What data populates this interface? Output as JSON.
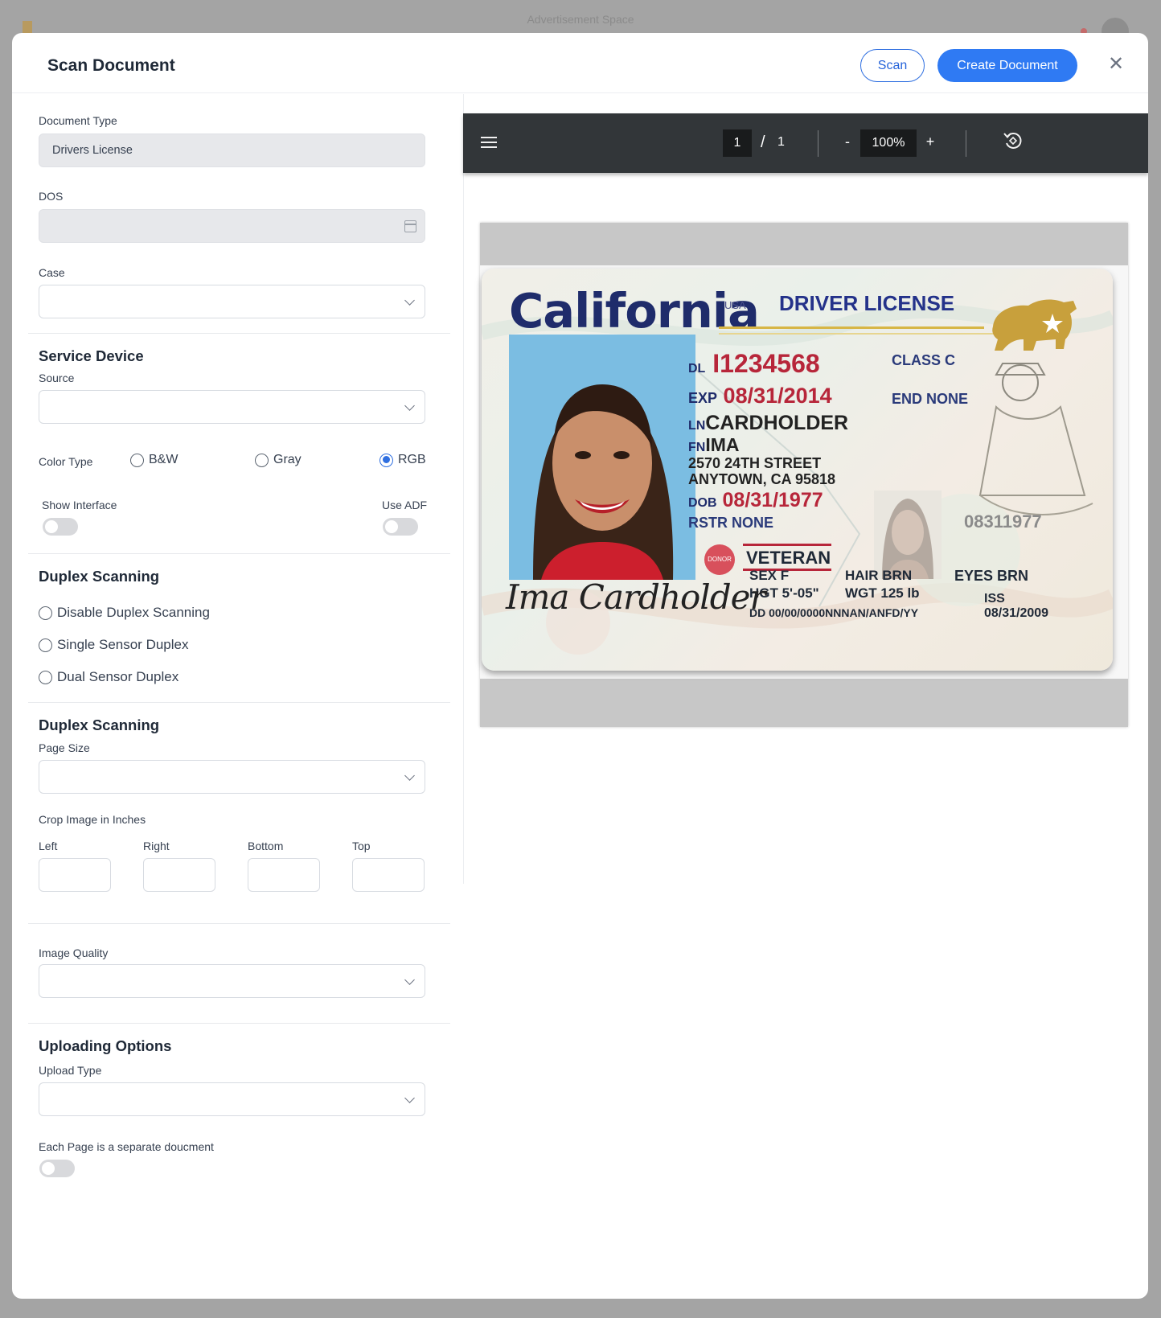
{
  "background": {
    "ad_text": "Advertisement Space"
  },
  "modal": {
    "title": "Scan Document",
    "scan_label": "Scan",
    "create_label": "Create Document",
    "close_glyph": "✕"
  },
  "form": {
    "document_type": {
      "label": "Document Type",
      "value": "Drivers License"
    },
    "dos": {
      "label": "DOS",
      "value": ""
    },
    "case": {
      "label": "Case",
      "value": ""
    },
    "service_device": {
      "title": "Service Device",
      "source_label": "Source",
      "source_value": "",
      "color_type_label": "Color Type",
      "color_options": [
        "B&W",
        "Gray",
        "RGB"
      ],
      "color_selected": "RGB",
      "show_interface_label": "Show Interface",
      "show_interface_on": false,
      "use_adf_label": "Use ADF",
      "use_adf_on": false
    },
    "duplex": {
      "title": "Duplex Scanning",
      "options": [
        "Disable Duplex Scanning",
        "Single Sensor Duplex",
        "Dual Sensor Duplex"
      ],
      "selected": null
    },
    "page": {
      "title": "Duplex Scanning",
      "page_size_label": "Page Size",
      "page_size_value": "",
      "crop_label": "Crop Image in Inches",
      "crop_fields": [
        "Left",
        "Right",
        "Bottom",
        "Top"
      ]
    },
    "image_quality": {
      "label": "Image Quality",
      "value": ""
    },
    "uploading": {
      "title": "Uploading Options",
      "upload_type_label": "Upload Type",
      "upload_type_value": "",
      "separate_label": "Each Page is a separate doucment",
      "separate_on": false
    }
  },
  "viewer": {
    "page_current": "1",
    "page_separator": "/",
    "page_total": "1",
    "zoom_minus": "-",
    "zoom_value": "100%",
    "zoom_plus": "+",
    "icons": [
      "menu-icon",
      "rotate-icon"
    ]
  },
  "license": {
    "state": "California",
    "country": "USA",
    "type": "DRIVER LICENSE",
    "dl_label": "DL",
    "dl_number": "I1234568",
    "exp_label": "EXP",
    "exp_date": "08/31/2014",
    "ln_label": "LN",
    "last_name": "CARDHOLDER",
    "fn_label": "FN",
    "first_name": "IMA",
    "address1": "2570 24TH STREET",
    "address2": "ANYTOWN, CA 95818",
    "dob_label": "DOB",
    "dob": "08/31/1977",
    "rstr": "RSTR NONE",
    "class": "CLASS C",
    "end": "END NONE",
    "ghost_number": "08311977",
    "donor": "DONOR",
    "veteran": "VETERAN",
    "sex": "SEX  F",
    "hgt": "HGT  5'-05\"",
    "hair": "HAIR  BRN",
    "wgt": "WGT  125 lb",
    "eyes": "EYES BRN",
    "iss_label": "ISS",
    "iss_date": "08/31/2009",
    "dd": "DD  00/00/0000NNNAN/ANFD/YY",
    "signature": "Ima Cardholder"
  },
  "colors": {
    "primary": "#2f7af3",
    "viewer_bar": "#323639",
    "overlay": "#a4a4a4"
  }
}
